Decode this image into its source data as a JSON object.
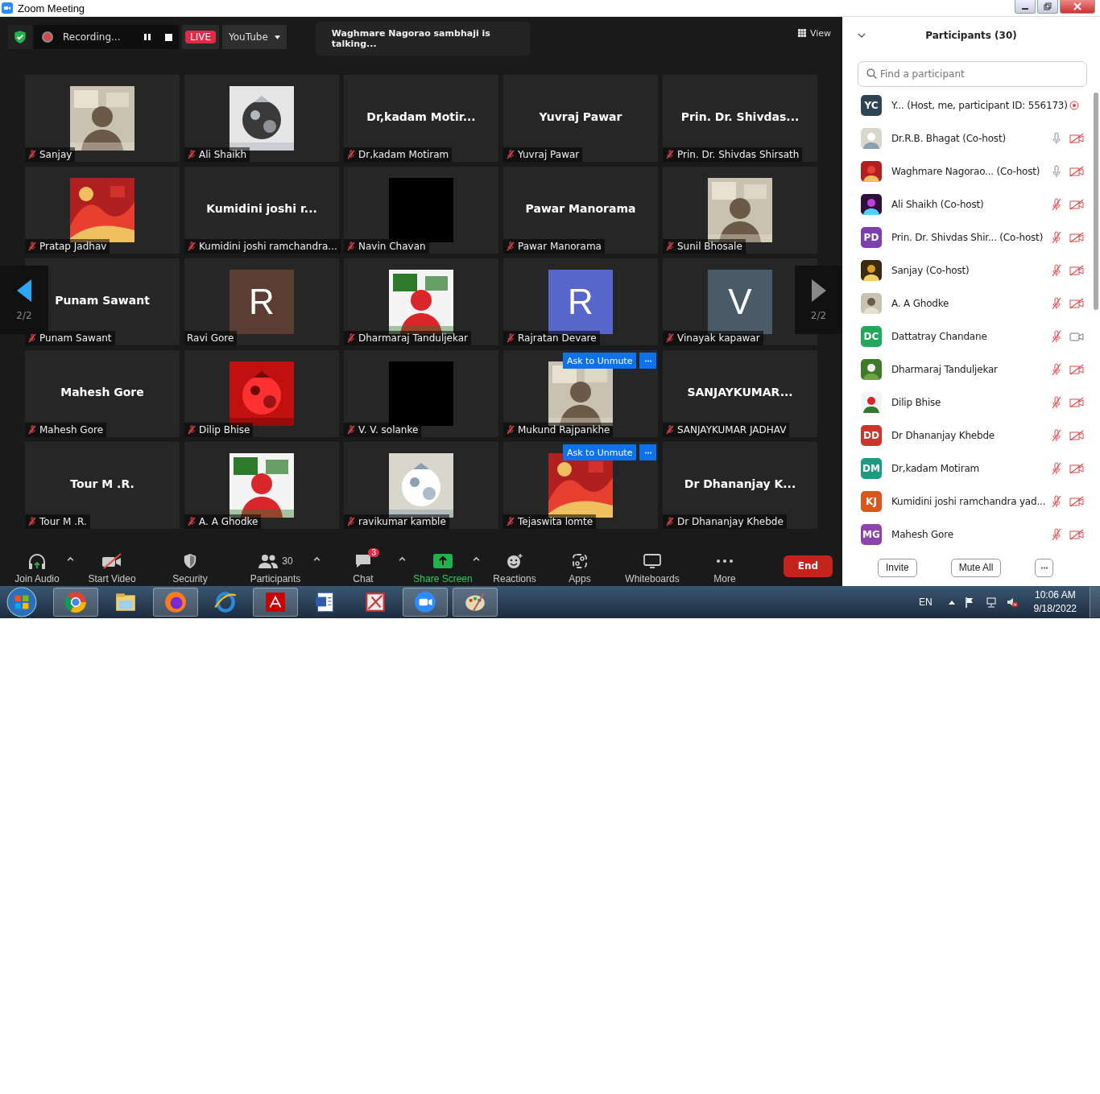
{
  "window": {
    "title": "Zoom Meeting"
  },
  "top_bar": {
    "recording": "Recording...",
    "live": "LIVE",
    "stream": "YouTube",
    "talking": "Waghmare Nagorao sambhaji is talking...",
    "view": "View"
  },
  "gallery": {
    "page_left": "2/2",
    "page_right": "2/2",
    "tiles": [
      {
        "kind": "picture",
        "label": "Sanjay",
        "mic_muted": true
      },
      {
        "kind": "picture",
        "label": "Ali Shaikh",
        "mic_muted": true
      },
      {
        "kind": "name",
        "name": "Dr,kadam  Motir...",
        "label": "Dr,kadam Motiram",
        "mic_muted": true
      },
      {
        "kind": "name",
        "name": "Yuvraj Pawar",
        "label": "Yuvraj Pawar",
        "mic_muted": true
      },
      {
        "kind": "name",
        "name": "Prin. Dr. Shivdas...",
        "label": "Prin. Dr. Shivdas Shirsath",
        "mic_muted": true
      },
      {
        "kind": "picture",
        "label": "Pratap Jadhav",
        "mic_muted": true
      },
      {
        "kind": "name",
        "name": "Kumidini joshi  r...",
        "label": "Kumidini joshi ramchandra...",
        "mic_muted": true
      },
      {
        "kind": "black",
        "label": "Navin Chavan",
        "mic_muted": true
      },
      {
        "kind": "name",
        "name": "Pawar Manorama",
        "label": "Pawar Manorama",
        "mic_muted": true
      },
      {
        "kind": "picture",
        "label": "Sunil Bhosale",
        "mic_muted": true
      },
      {
        "kind": "name",
        "name": "Punam Sawant",
        "label": "Punam Sawant",
        "mic_muted": true
      },
      {
        "kind": "letter",
        "letter": "R",
        "color": "#5c3d33",
        "label": "Ravi Gore",
        "mic_muted": false
      },
      {
        "kind": "picture",
        "label": "Dharmaraj Tanduljekar",
        "mic_muted": true
      },
      {
        "kind": "letter",
        "letter": "R",
        "color": "#5865c9",
        "label": "Rajratan Devare",
        "mic_muted": true
      },
      {
        "kind": "letter",
        "letter": "V",
        "color": "#4a5a66",
        "label": "Vinayak kapawar",
        "mic_muted": true
      },
      {
        "kind": "name",
        "name": "Mahesh Gore",
        "label": "Mahesh Gore",
        "mic_muted": true
      },
      {
        "kind": "picture",
        "label": "Dilip Bhise",
        "mic_muted": true
      },
      {
        "kind": "black",
        "label": "V. V. solanke",
        "mic_muted": true
      },
      {
        "kind": "picture",
        "label": "Mukund Rajpankhe",
        "mic_muted": true,
        "ask_to_unmute": "Ask to Unmute"
      },
      {
        "kind": "name",
        "name": "SANJAYKUMAR...",
        "label": "SANJAYKUMAR JADHAV",
        "mic_muted": true
      },
      {
        "kind": "name",
        "name": "Tour M .R.",
        "label": "Tour M .R.",
        "mic_muted": true
      },
      {
        "kind": "picture",
        "label": "A. A Ghodke",
        "mic_muted": true
      },
      {
        "kind": "picture",
        "label": "ravikumar kamble",
        "mic_muted": true
      },
      {
        "kind": "picture",
        "label": "Tejaswita lomte",
        "mic_muted": true,
        "ask_to_unmute": "Ask to Unmute"
      },
      {
        "kind": "name",
        "name": "Dr Dhananjay K...",
        "label": "Dr Dhananjay Khebde",
        "mic_muted": true
      }
    ]
  },
  "toolbar": [
    {
      "kind": "audio",
      "label": "Join Audio",
      "caret": true
    },
    {
      "kind": "video",
      "label": "Start Video",
      "caret": false
    },
    {
      "kind": "security",
      "label": "Security",
      "caret": false
    },
    {
      "kind": "participants",
      "label": "Participants",
      "count": "30",
      "caret": true
    },
    {
      "kind": "chat",
      "label": "Chat",
      "badge": "3",
      "caret": true
    },
    {
      "kind": "share",
      "label": "Share Screen",
      "caret": true
    },
    {
      "kind": "reactions",
      "label": "Reactions",
      "caret": false
    },
    {
      "kind": "apps",
      "label": "Apps",
      "caret": false
    },
    {
      "kind": "whiteboards",
      "label": "Whiteboards",
      "caret": false
    },
    {
      "kind": "more",
      "label": "More",
      "caret": false
    }
  ],
  "end_button": "End",
  "participants_panel": {
    "title": "Participants (30)",
    "search": {
      "placeholder": "Find a participant"
    },
    "participants": [
      {
        "kind": "host",
        "initials": "YC",
        "color": "#2d4356",
        "name": "Y... (Host, me, participant ID: 556173)",
        "recording": true
      },
      {
        "kind": "member",
        "name": "Dr.R.B. Bhagat (Co-host)",
        "mic_muted": false,
        "video_on": false,
        "recording": false
      },
      {
        "kind": "member",
        "name": "Waghmare Nagorao...  (Co-host)",
        "mic_muted": false,
        "video_on": false,
        "recording": false
      },
      {
        "kind": "member",
        "name": "Ali Shaikh (Co-host)",
        "mic_muted": true,
        "video_on": false,
        "recording": false
      },
      {
        "kind": "member",
        "initials": "PD",
        "color": "#7b3fb0",
        "name": "Prin. Dr. Shivdas Shir...  (Co-host)",
        "mic_muted": true,
        "video_on": false,
        "recording": false
      },
      {
        "kind": "member",
        "name": "Sanjay (Co-host)",
        "mic_muted": true,
        "video_on": false,
        "recording": false
      },
      {
        "kind": "member",
        "name": "A. A Ghodke",
        "mic_muted": true,
        "video_on": false,
        "recording": false
      },
      {
        "kind": "member",
        "initials": "DC",
        "color": "#22a85a",
        "name": "Dattatray Chandane",
        "mic_muted": true,
        "video_on": true,
        "recording": false
      },
      {
        "kind": "member",
        "name": "Dharmaraj Tanduljekar",
        "mic_muted": true,
        "video_on": false,
        "recording": false
      },
      {
        "kind": "member",
        "name": "Dilip Bhise",
        "mic_muted": true,
        "video_on": false,
        "recording": false
      },
      {
        "kind": "member",
        "initials": "DD",
        "color": "#c9362e",
        "name": "Dr Dhananjay Khebde",
        "mic_muted": true,
        "video_on": false,
        "recording": false
      },
      {
        "kind": "member",
        "initials": "DM",
        "color": "#1d9a82",
        "name": "Dr,kadam Motiram",
        "mic_muted": true,
        "video_on": false,
        "recording": false
      },
      {
        "kind": "member",
        "initials": "KJ",
        "color": "#d9571a",
        "name": "Kumidini joshi ramchandra yad...",
        "mic_muted": true,
        "video_on": false,
        "recording": false
      },
      {
        "kind": "member",
        "initials": "MG",
        "color": "#8e44ad",
        "name": "Mahesh Gore",
        "mic_muted": true,
        "video_on": false,
        "recording": false
      }
    ],
    "buttons": [
      "Invite",
      "Mute All"
    ]
  },
  "taskbar": {
    "language": "EN",
    "time": "10:06 AM",
    "date": "9/18/2022"
  }
}
